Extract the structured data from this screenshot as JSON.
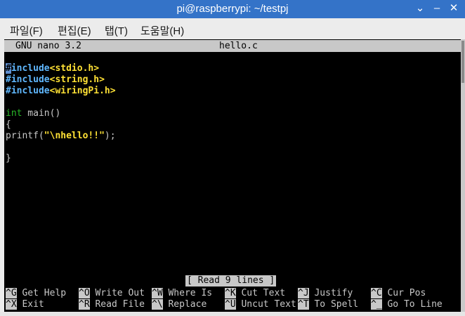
{
  "window": {
    "title": "pi@raspberrypi: ~/testpj",
    "controls": [
      "⌄",
      "–",
      "✕"
    ]
  },
  "menu": [
    {
      "label": "파일(F)"
    },
    {
      "label": "편집(E)"
    },
    {
      "label": "탭(T)"
    },
    {
      "label": "도움말(H)"
    }
  ],
  "nano": {
    "version": "GNU nano 3.2",
    "filename": "hello.c",
    "cursor_char": "#",
    "lines": {
      "l1_rest": "include",
      "l1_hdr": "<stdio.h>",
      "l2_kw": "#include",
      "l2_hdr": "<string.h>",
      "l3_kw": "#include",
      "l3_hdr": "<wiringPi.h>",
      "l5_kw": "int",
      "l5_rest": " main()",
      "l6": "{",
      "l7_pre": "printf(",
      "l7_str": "\"\\nhello!!\"",
      "l7_post": ");",
      "l9": "}"
    },
    "status": "[ Read 9 lines ]",
    "shortcuts_row1": [
      {
        "key": "^G",
        "label": " Get Help"
      },
      {
        "key": "^O",
        "label": " Write Out"
      },
      {
        "key": "^W",
        "label": " Where Is"
      },
      {
        "key": "^K",
        "label": " Cut Text"
      },
      {
        "key": "^J",
        "label": " Justify"
      },
      {
        "key": "^C",
        "label": " Cur Pos"
      }
    ],
    "shortcuts_row2": [
      {
        "key": "^X",
        "label": " Exit"
      },
      {
        "key": "^R",
        "label": " Read File"
      },
      {
        "key": "^\\",
        "label": " Replace"
      },
      {
        "key": "^U",
        "label": " Uncut Text"
      },
      {
        "key": "^T",
        "label": " To Spell"
      },
      {
        "key": "^_",
        "label": " Go To Line"
      }
    ]
  }
}
